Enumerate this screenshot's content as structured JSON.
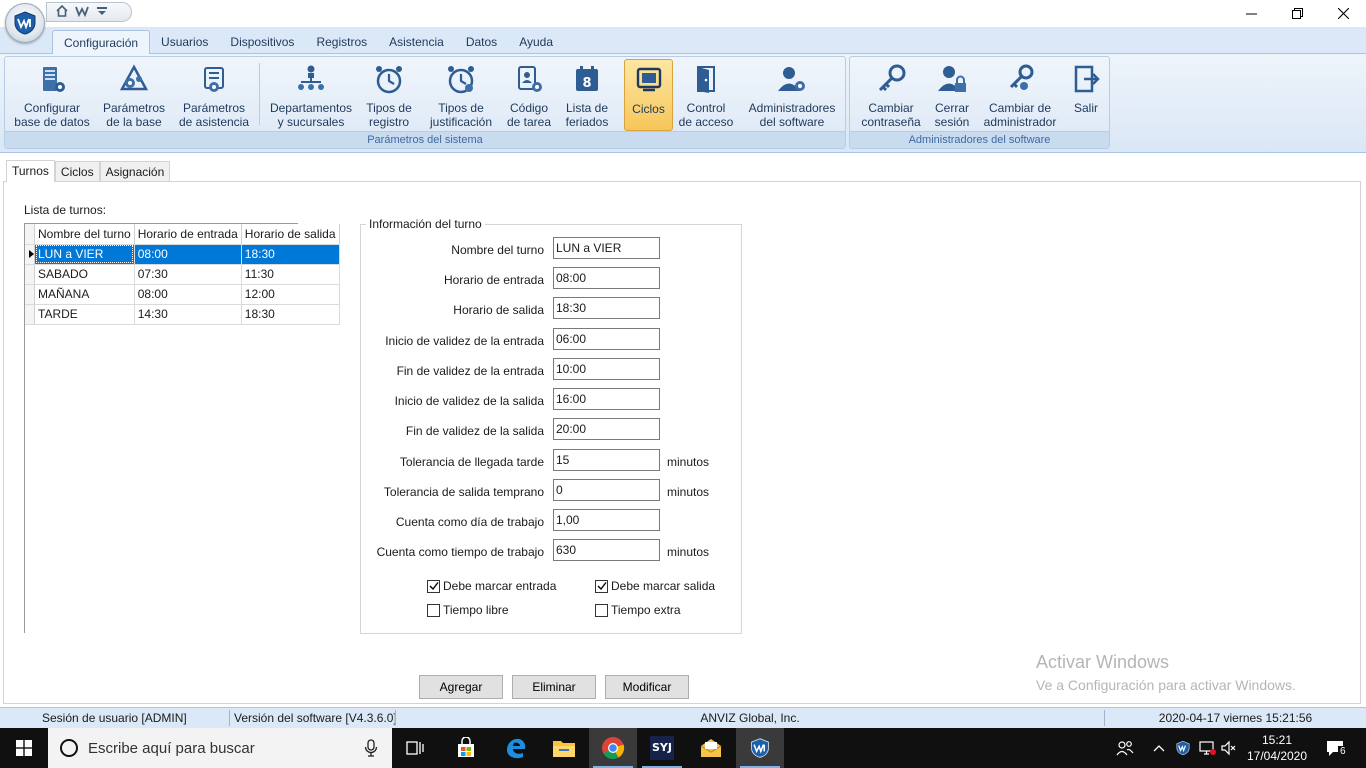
{
  "titlebar": {
    "qat_icons": [
      "home-icon",
      "logo-icon",
      "dropdown-icon"
    ]
  },
  "tabs": [
    {
      "label": "Configuración",
      "active": true
    },
    {
      "label": "Usuarios"
    },
    {
      "label": "Dispositivos"
    },
    {
      "label": "Registros"
    },
    {
      "label": "Asistencia"
    },
    {
      "label": "Datos"
    },
    {
      "label": "Ayuda"
    }
  ],
  "ribbon": {
    "group1_label": "Parámetros del sistema",
    "group2_label": "Administradores del software",
    "buttons": {
      "config_db": [
        "Configurar",
        "base de datos"
      ],
      "db_params": [
        "Parámetros",
        "de la base"
      ],
      "att_params": [
        "Parámetros",
        "de asistencia"
      ],
      "departments": [
        "Departamentos",
        "y sucursales"
      ],
      "record_types": [
        "Tipos de",
        "registro"
      ],
      "justification": [
        "Tipos de",
        "justificación"
      ],
      "task_code": [
        "Código",
        "de tarea"
      ],
      "holidays": [
        "Lista de",
        "feriados"
      ],
      "cycles": [
        "Ciclos",
        ""
      ],
      "access": [
        "Control",
        "de acceso"
      ],
      "admins": [
        "Administradores",
        "del software"
      ],
      "change_pw": [
        "Cambiar",
        "contraseña"
      ],
      "logout": [
        "Cerrar",
        "sesión"
      ],
      "change_admin": [
        "Cambiar de",
        "administrador"
      ],
      "exit": [
        "Salir",
        ""
      ]
    }
  },
  "subtabs": [
    "Turnos",
    "Ciclos",
    "Asignación"
  ],
  "list": {
    "label": "Lista de turnos:",
    "columns": [
      "Nombre del turno",
      "Horario de entrada",
      "Horario de salida"
    ],
    "rows": [
      [
        "LUN a VIER",
        "08:00",
        "18:30"
      ],
      [
        "SABADO",
        "07:30",
        "11:30"
      ],
      [
        "MAÑANA",
        "08:00",
        "12:00"
      ],
      [
        "TARDE",
        "14:30",
        "18:30"
      ]
    ]
  },
  "form": {
    "legend": "Información del turno",
    "fields": [
      {
        "label": "Nombre del turno",
        "value": "LUN a VIER",
        "unit": ""
      },
      {
        "label": "Horario de entrada",
        "value": "08:00",
        "unit": ""
      },
      {
        "label": "Horario de salida",
        "value": "18:30",
        "unit": ""
      },
      {
        "label": "Inicio de validez de la entrada",
        "value": "06:00",
        "unit": ""
      },
      {
        "label": "Fin de validez de la entrada",
        "value": "10:00",
        "unit": ""
      },
      {
        "label": "Inicio de validez de la salida",
        "value": "16:00",
        "unit": ""
      },
      {
        "label": "Fin de validez de la salida",
        "value": "20:00",
        "unit": ""
      },
      {
        "label": "Tolerancia de llegada tarde",
        "value": "15",
        "unit": "minutos"
      },
      {
        "label": "Tolerancia de salida temprano",
        "value": "0",
        "unit": "minutos"
      },
      {
        "label": "Cuenta como día de trabajo",
        "value": "1,00",
        "unit": ""
      },
      {
        "label": "Cuenta como tiempo de trabajo",
        "value": "630",
        "unit": "minutos"
      }
    ],
    "checks": [
      {
        "label": "Debe marcar entrada",
        "checked": true
      },
      {
        "label": "Debe marcar salida",
        "checked": true
      },
      {
        "label": "Tiempo libre",
        "checked": false
      },
      {
        "label": "Tiempo extra",
        "checked": false
      }
    ]
  },
  "buttons": {
    "add": "Agregar",
    "delete": "Eliminar",
    "modify": "Modificar"
  },
  "watermark": {
    "line1": "Activar Windows",
    "line2": "Ve a Configuración para activar Windows."
  },
  "status": {
    "session": "Sesión de usuario  [ADMIN]",
    "version": "Versión del software  [V4.3.6.0]",
    "company": "ANVIZ Global, Inc.",
    "datetime": "2020-04-17 viernes 15:21:56"
  },
  "taskbar": {
    "search_placeholder": "Escribe aquí para buscar",
    "time": "15:21",
    "date": "17/04/2020",
    "notification_count": "6",
    "syj_label": "SYJ"
  },
  "colors": {
    "ribbon_bg": "#dbe8f7",
    "accent": "#0078d7",
    "selected_button": "#f7c65a"
  }
}
